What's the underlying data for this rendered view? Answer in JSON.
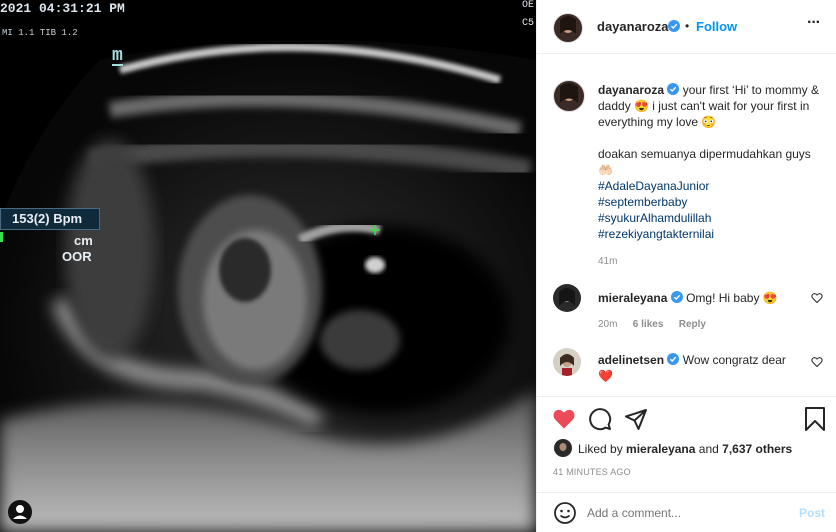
{
  "ultrasound": {
    "datetime": "2021  04:31:21 PM",
    "params": "MI 1.1 TIB 1.2",
    "corner_top": "OE",
    "corner_bottom": "C5",
    "mode_letter": "m",
    "bpm": "153(2) Bpm",
    "unit": "cm",
    "range": "OOR"
  },
  "header": {
    "username": "dayanaroza",
    "dot": "•",
    "follow_label": "Follow",
    "more_label": "···"
  },
  "caption": {
    "username": "dayanaroza",
    "text": "your first ‘Hi’ to mommy & daddy 😍 i just can't wait for your first in everything my love 😳",
    "text2": "doakan semuanya dipermudahkan guys 🤲🏻",
    "hashtags": [
      "#AdaleDayanaJunior",
      "#septemberbaby",
      "#syukurAlhamdulillah",
      "#rezekiyangtakternilai"
    ],
    "time": "41m"
  },
  "comments": [
    {
      "username": "mieraleyana",
      "text": "Omg! Hi baby 😍",
      "time": "20m",
      "likes": "6 likes",
      "reply": "Reply"
    },
    {
      "username": "adelinetsen",
      "text": "Wow congratz dear ❤️"
    }
  ],
  "likes": {
    "prefix": "Liked by",
    "user": "mieraleyana",
    "and": "and",
    "count": "7,637 others"
  },
  "post_time": "41 MINUTES AGO",
  "add_comment": {
    "placeholder": "Add a comment...",
    "post_label": "Post"
  },
  "colors": {
    "accent": "#0095f6",
    "heart": "#ed4956",
    "link": "#00376b",
    "verified": "#3897f0"
  }
}
